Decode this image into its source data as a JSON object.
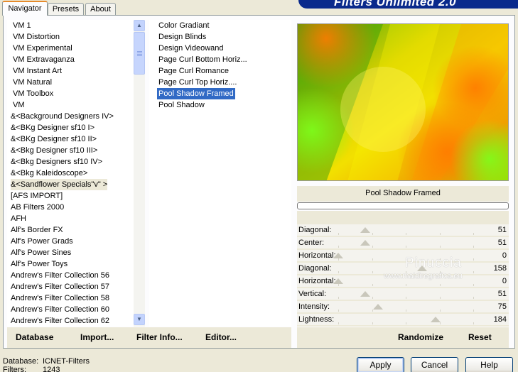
{
  "header": {
    "banner_text": "Filters Unlimited 2.0",
    "tabs": [
      {
        "label": "Navigator",
        "active": true
      },
      {
        "label": "Presets",
        "active": false
      },
      {
        "label": "About",
        "active": false
      }
    ]
  },
  "categories": {
    "selected_index": 14,
    "items": [
      "VM 1",
      "VM Distortion",
      "VM Experimental",
      "VM Extravaganza",
      "VM Instant Art",
      "VM Natural",
      "VM Toolbox",
      "VM",
      "&<Background Designers IV>",
      "&<BKg Designer sf10 I>",
      "&<BKg Designer sf10 II>",
      "&<Bkg Designer sf10 III>",
      "&<Bkg Designers sf10 IV>",
      "&<Bkg Kaleidoscope>",
      "&<Sandflower Specials\"v\" >",
      "[AFS IMPORT]",
      "AB Filters 2000",
      "AFH",
      "Alf's Border FX",
      "Alf's Power Grads",
      "Alf's Power Sines",
      "Alf's Power Toys",
      "Andrew's Filter Collection 56",
      "Andrew's Filter Collection 57",
      "Andrew's Filter Collection 58",
      "Andrew's Filter Collection 60",
      "Andrew's Filter Collection 62"
    ]
  },
  "filters": {
    "selected_index": 6,
    "items": [
      "Color Gradiant",
      "Design Blinds",
      "Design Videowand",
      "Page Curl Bottom Horiz...",
      "Page Curl Romance",
      "Page Curl Top Horiz....",
      "Pool Shadow Framed",
      "Pool Shadow"
    ]
  },
  "preview": {
    "filter_name": "Pool Shadow Framed",
    "progress_percent": 0
  },
  "parameters": [
    {
      "label": "Diagonal:",
      "value": "51",
      "level": 51
    },
    {
      "label": "Center:",
      "value": "51",
      "level": 51
    },
    {
      "label": "Horizontal:",
      "value": "0",
      "level": 0
    },
    {
      "label": "Diagonal:",
      "value": "158",
      "level": 158
    },
    {
      "label": "Horizontal:",
      "value": "0",
      "level": 0
    },
    {
      "label": "Vertical:",
      "value": "51",
      "level": 51
    },
    {
      "label": "Intensity:",
      "value": "75",
      "level": 75
    },
    {
      "label": "Lightness:",
      "value": "184",
      "level": 184
    }
  ],
  "watermark": {
    "name": "Pinuccia",
    "url": "www.maidiregrafica.eu"
  },
  "left_bar": {
    "database": "Database",
    "import": "Import...",
    "filter_info": "Filter Info...",
    "editor": "Editor..."
  },
  "right_bar": {
    "randomize": "Randomize",
    "reset": "Reset"
  },
  "status": {
    "database_label": "Database:",
    "database_value": "ICNET-Filters",
    "filters_label": "Filters:",
    "filters_value": "1243"
  },
  "buttons": {
    "apply": "Apply",
    "cancel": "Cancel",
    "help": "Help"
  },
  "colors": {
    "selection": "#316ac5",
    "banner": "#0a2a8c",
    "tab_accent": "#e68b2c"
  }
}
